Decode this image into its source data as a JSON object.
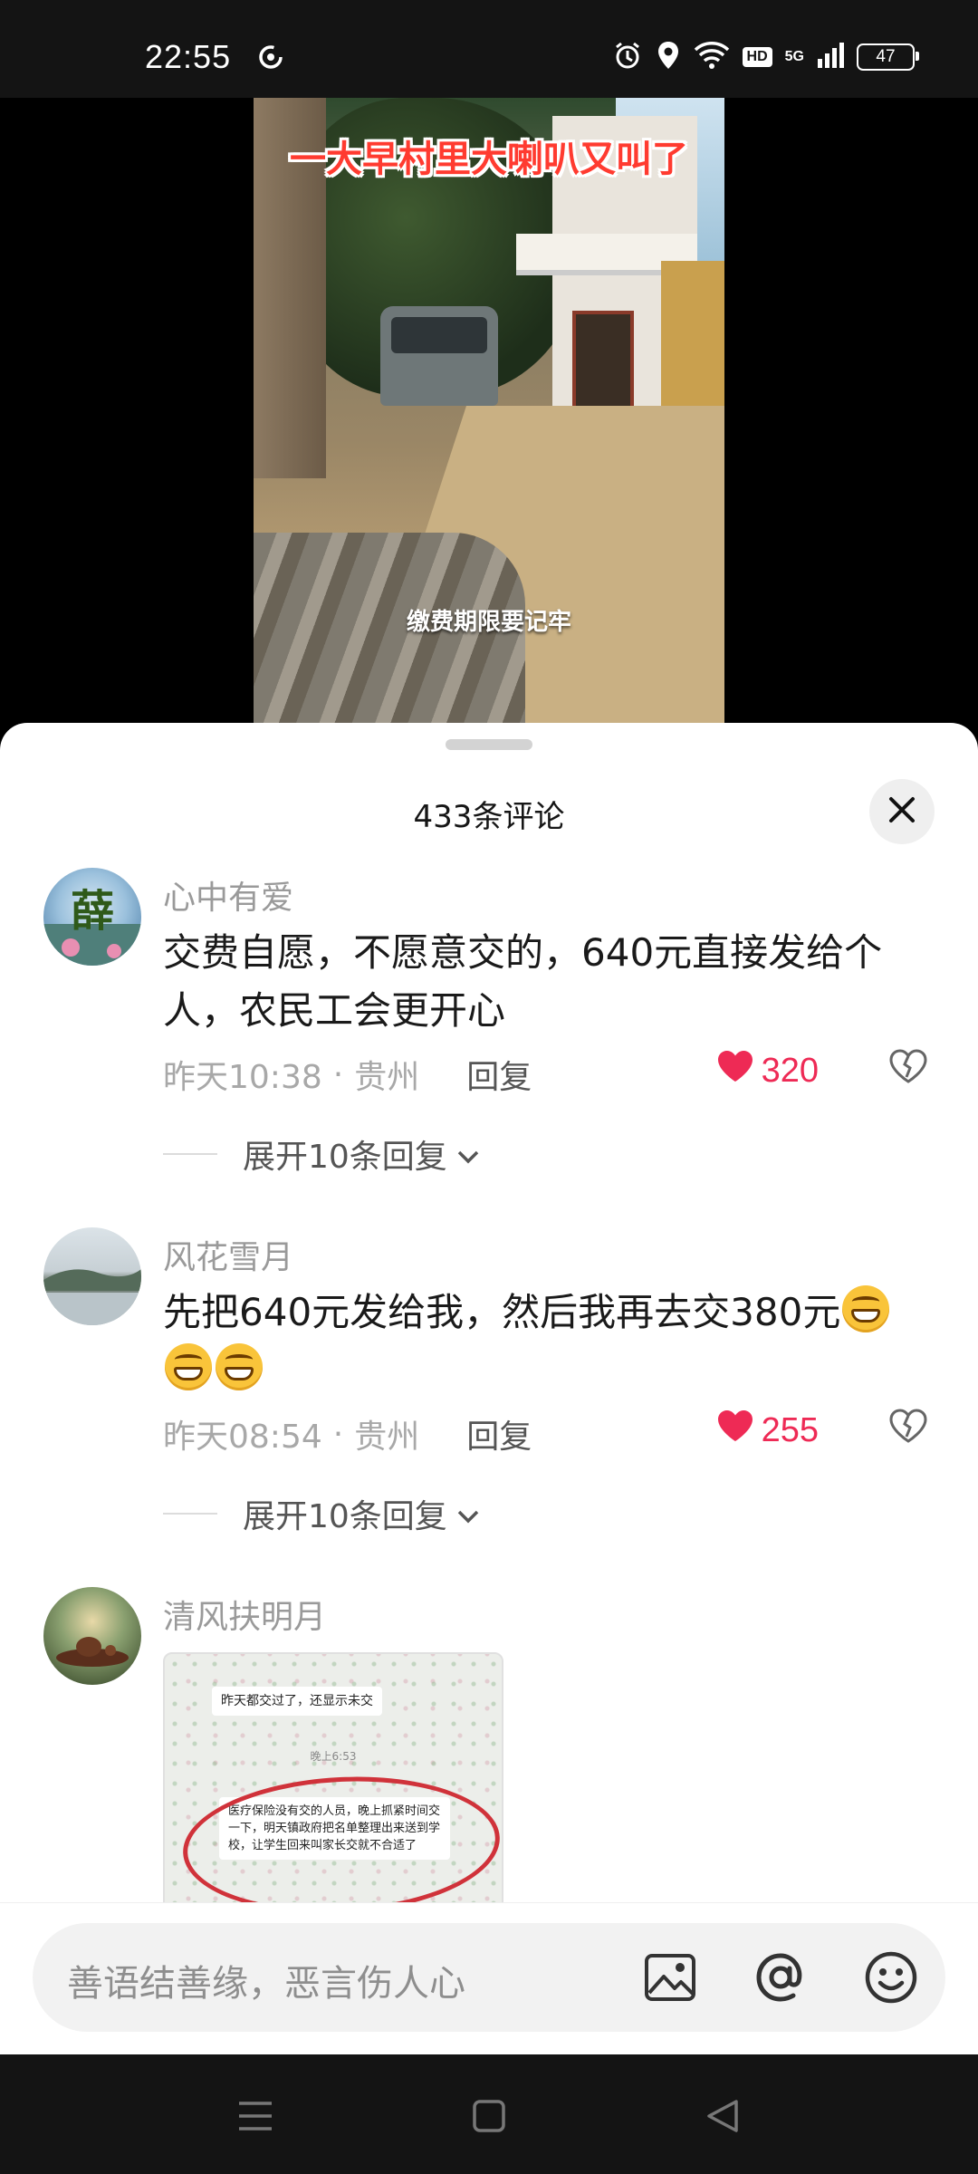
{
  "status_bar": {
    "time": "22:55",
    "network": "5G",
    "hd": "HD",
    "battery": "47",
    "icons": [
      "sync-icon",
      "alarm-icon",
      "location-icon",
      "wifi-icon",
      "signal-icon",
      "battery-icon"
    ]
  },
  "video": {
    "caption": "一大早村里大喇叭又叫了",
    "subtitle": "缴费期限要记牢"
  },
  "comments_panel": {
    "title": "433条评论",
    "comments": [
      {
        "user": "心中有爱",
        "avatar_text": "薛",
        "text": "交费自愿，不愿意交的，640元直接发给个人，农民工会更开心",
        "time": "昨天10:38",
        "sep": "·",
        "location": "贵州",
        "reply": "回复",
        "likes": "320",
        "expand": "展开10条回复"
      },
      {
        "user": "风花雪月",
        "text": "先把640元发给我，然后我再去交380元",
        "emoji_count": 3,
        "time": "昨天08:54",
        "sep": "·",
        "location": "贵州",
        "reply": "回复",
        "likes": "255",
        "expand": "展开10条回复"
      },
      {
        "user": "清风扶明月",
        "image": {
          "msg1": "昨天都交过了，还显示未交",
          "time": "晚上6:53",
          "msg2": "医疗保险没有交的人员，晚上抓紧时间交一下，明天镇政府把名单整理出来送到学校，让学生回来叫家长交就不合适了"
        }
      }
    ]
  },
  "input": {
    "placeholder": "善语结善缘，恶言伤人心"
  },
  "colors": {
    "like": "#ee2a55",
    "sheet_bg": "#ffffff",
    "input_bg": "#f2f2f2"
  }
}
